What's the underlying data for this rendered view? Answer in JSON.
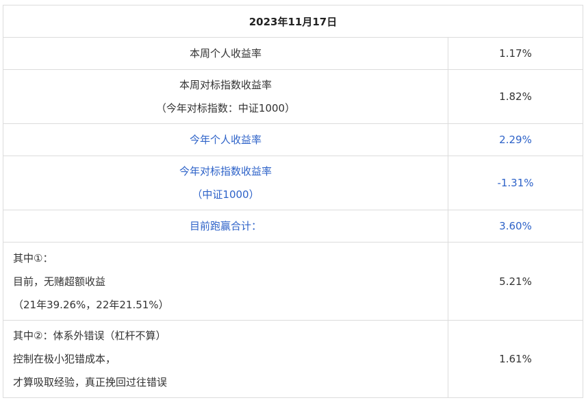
{
  "title": "2023年11月17日",
  "rows": [
    {
      "label_lines": [
        "本周个人收益率"
      ],
      "value": "1.17%"
    },
    {
      "label_lines": [
        "本周对标指数收益率",
        "（今年对标指数：中证1000）"
      ],
      "value": "1.82%"
    },
    {
      "label_lines": [
        "今年个人收益率"
      ],
      "value": "2.29%"
    },
    {
      "label_lines": [
        "今年对标指数收益率",
        "（中证1000）"
      ],
      "value": "-1.31%"
    },
    {
      "label_lines": [
        "目前跑赢合计："
      ],
      "value": "3.60%"
    },
    {
      "label_lines": [
        "其中①：",
        "目前，无赌超额收益",
        "（21年39.26%，22年21.51%）"
      ],
      "value": "5.21%"
    },
    {
      "label_lines": [
        "其中②：体系外错误（杠杆不算）",
        "控制在极小犯错成本，",
        "才算吸取经验，真正挽回过往错误"
      ],
      "value": "1.61%"
    }
  ],
  "colors": {
    "highlight_text": "#2d62c8",
    "normal_text": "#333333",
    "border": "#dcdcdc"
  }
}
